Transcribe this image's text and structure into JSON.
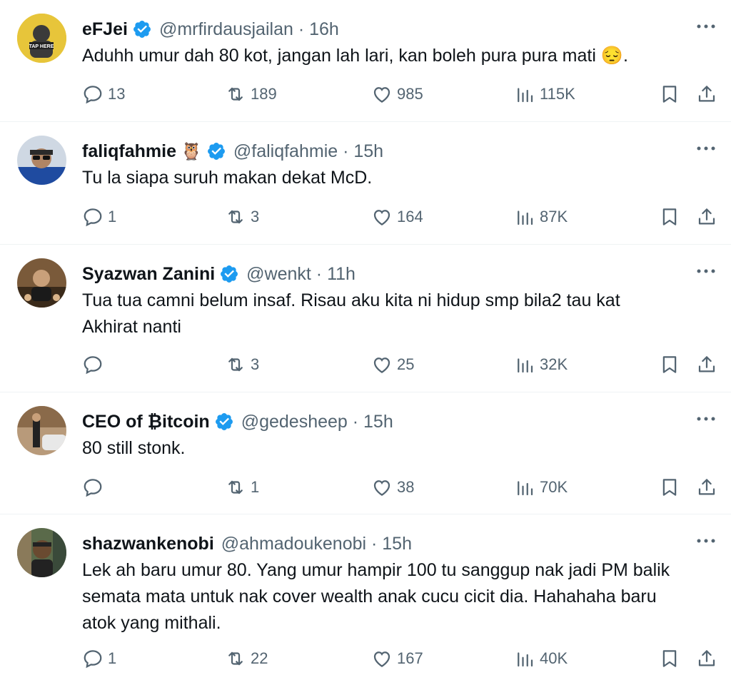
{
  "tweets": [
    {
      "name": "eFJei",
      "verified": true,
      "emoji_after_name": "",
      "handle": "@mrfirdausjailan · 16h",
      "text": "Aduhh umur dah 80 kot, jangan lah lari, kan boleh pura pura mati 😔.",
      "replies": "13",
      "retweets": "189",
      "likes": "985",
      "views": "115K",
      "avatar_text": "TAP HERE",
      "avatar_color": "#e8c93a"
    },
    {
      "name": "faliqfahmie",
      "verified": true,
      "emoji_after_name": "🦉",
      "handle": "@faliqfahmie · 15h",
      "text": "Tu la siapa suruh makan dekat McD.",
      "replies": "1",
      "retweets": "3",
      "likes": "164",
      "views": "87K",
      "avatar_text": "",
      "avatar_color": "#2f4f8a"
    },
    {
      "name": "Syazwan Zanini",
      "verified": true,
      "emoji_after_name": "",
      "handle": "@wenkt · 11h",
      "text": "Tua tua camni belum insaf. Risau aku kita ni hidup smp bila2 tau kat\nAkhirat nanti",
      "replies": "",
      "retweets": "3",
      "likes": "25",
      "views": "32K",
      "avatar_text": "",
      "avatar_color": "#6b4a2e"
    },
    {
      "name": "CEO of ₿itcoin",
      "verified": true,
      "emoji_after_name": "",
      "handle": "@gedesheep · 15h",
      "text": "80 still stonk.",
      "replies": "",
      "retweets": "1",
      "likes": "38",
      "views": "70K",
      "avatar_text": "",
      "avatar_color": "#8a7a6a"
    },
    {
      "name": "shazwankenobi",
      "verified": false,
      "emoji_after_name": "",
      "handle": "@ahmadoukenobi · 15h",
      "text": "Lek ah baru umur 80. Yang umur hampir 100 tu sanggup nak jadi PM balik\nsemata mata untuk nak cover wealth anak cucu cicit dia. Hahahaha baru\natok yang mithali.",
      "replies": "1",
      "retweets": "22",
      "likes": "167",
      "views": "40K",
      "avatar_text": "",
      "avatar_color": "#4a5a3a"
    }
  ],
  "colors": {
    "accent": "#1d9bf0",
    "muted": "#536471",
    "text": "#0f1419",
    "divider": "#eff3f4"
  }
}
